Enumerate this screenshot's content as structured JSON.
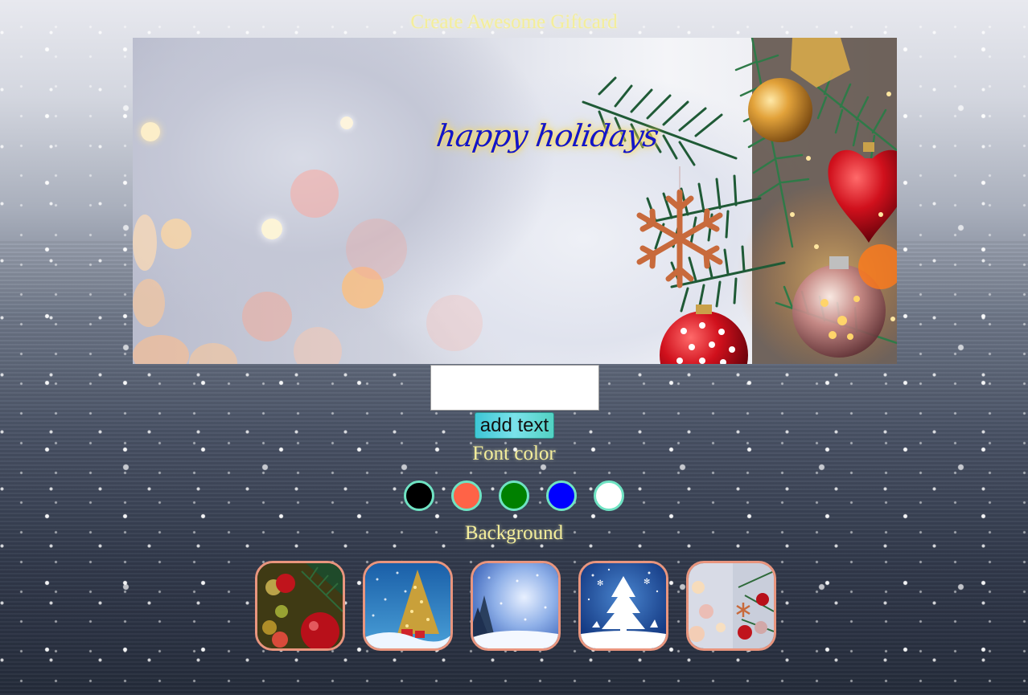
{
  "page": {
    "title": "Create Awesome Giftcard"
  },
  "card": {
    "text": "happy holidays",
    "text_color": "#1416c8",
    "glow_color": "#ffd94a"
  },
  "text_input": {
    "value": "",
    "placeholder": ""
  },
  "add_button": {
    "label": "add text"
  },
  "font_color": {
    "label": "Font color",
    "swatches": [
      {
        "name": "black",
        "color": "#000000"
      },
      {
        "name": "tomato",
        "color": "#ff6347"
      },
      {
        "name": "green",
        "color": "#008000"
      },
      {
        "name": "blue",
        "color": "#0000ff"
      },
      {
        "name": "white",
        "color": "#ffffff"
      }
    ]
  },
  "background": {
    "label": "Background",
    "options": [
      {
        "name": "ornaments-closeup"
      },
      {
        "name": "decorated-tree-blue"
      },
      {
        "name": "snowy-forest"
      },
      {
        "name": "white-tree-silhouette"
      },
      {
        "name": "bokeh-tree-branch"
      }
    ]
  },
  "colors": {
    "label_yellow": "#f4ee9a",
    "button_teal": "#52d1c2",
    "swatch_border": "#6fe3c3",
    "thumb_border": "#e9957e"
  }
}
